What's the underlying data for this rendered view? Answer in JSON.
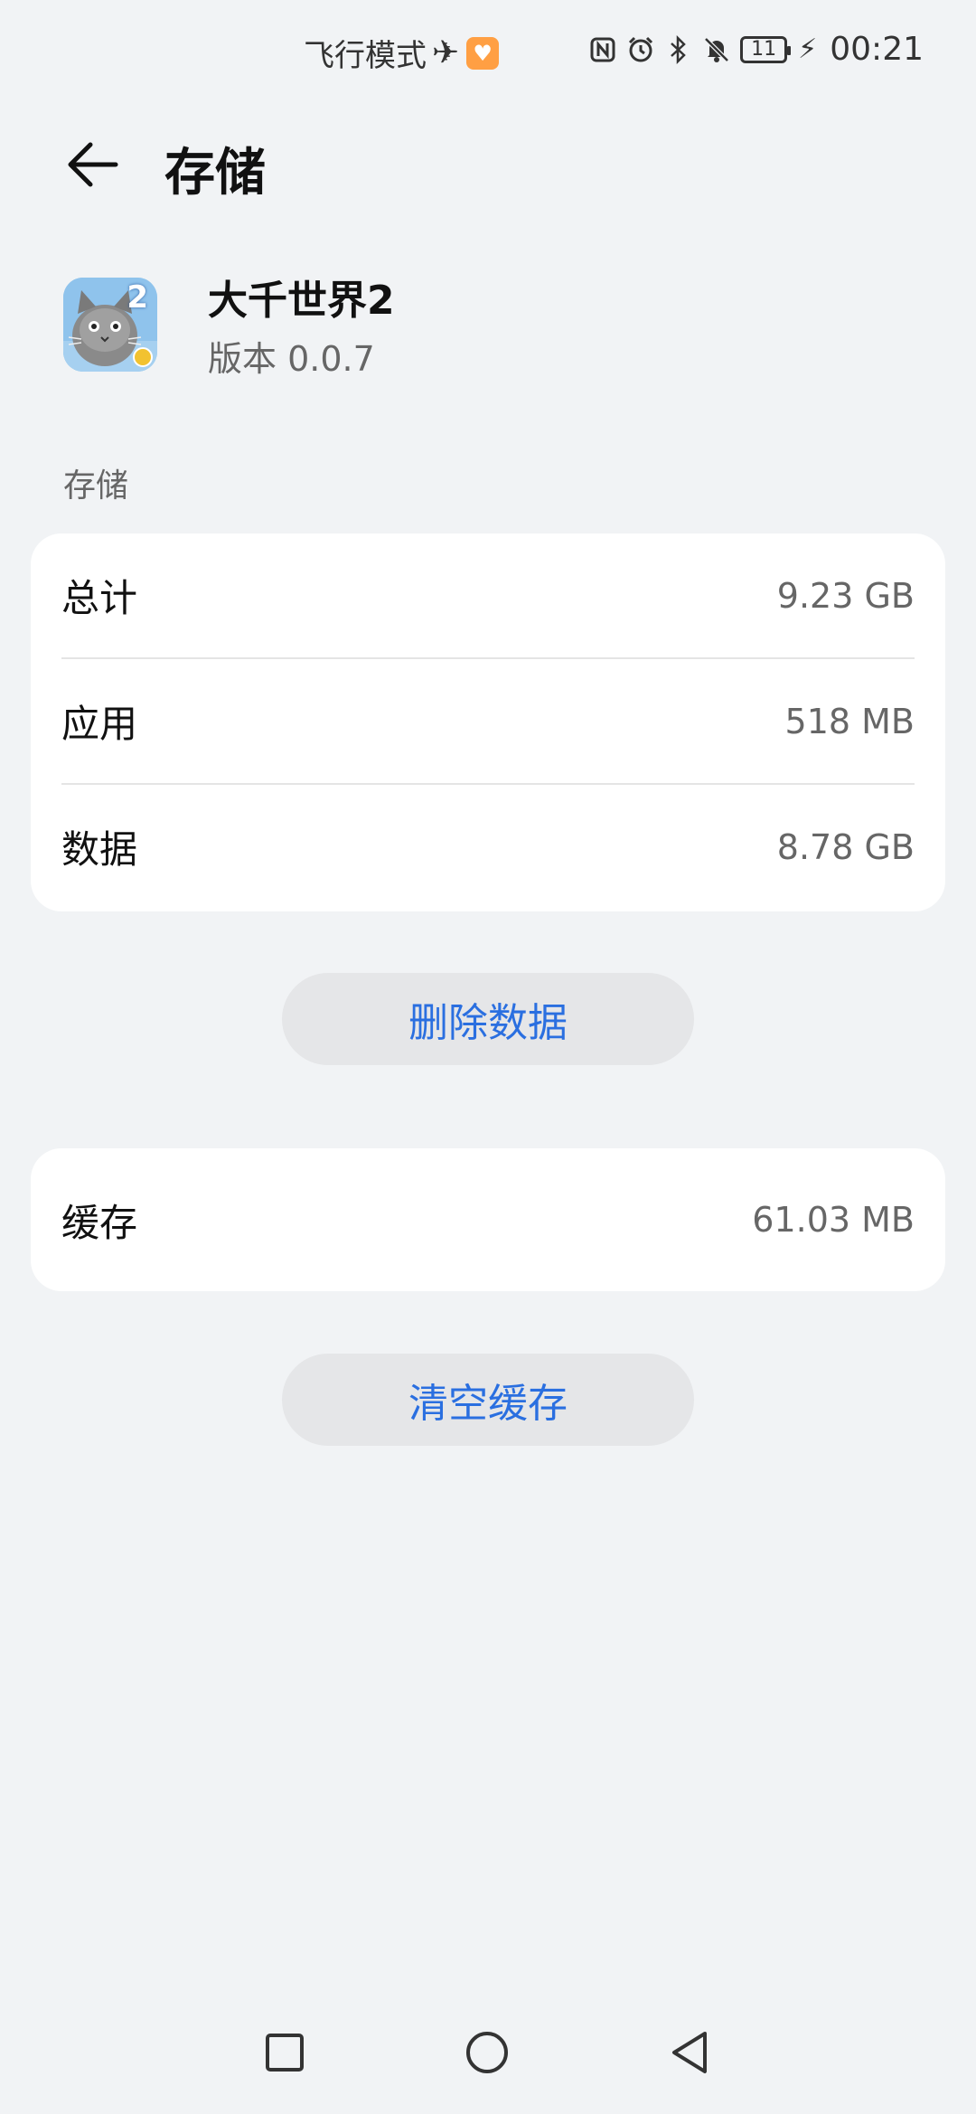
{
  "status_bar": {
    "airplane_mode_label": "飞行模式",
    "battery_level": "11",
    "time": "00:21"
  },
  "header": {
    "title": "存储"
  },
  "app": {
    "name": "大千世界2",
    "version": "版本 0.0.7",
    "icon_badge_number": "2"
  },
  "storage_section": {
    "label": "存储",
    "rows": [
      {
        "label": "总计",
        "value": "9.23 GB"
      },
      {
        "label": "应用",
        "value": "518 MB"
      },
      {
        "label": "数据",
        "value": "8.78 GB"
      }
    ],
    "delete_button": "删除数据"
  },
  "cache_section": {
    "label": "缓存",
    "value": "61.03 MB",
    "clear_button": "清空缓存"
  },
  "icons": {
    "back": "back-arrow-icon",
    "airplane": "airplane-icon",
    "health": "health-app-icon",
    "nfc": "nfc-icon",
    "alarm": "alarm-icon",
    "bluetooth": "bluetooth-icon",
    "mute": "bell-muted-icon",
    "charging": "charging-bolt-icon"
  },
  "colors": {
    "accent": "#2a6fe0",
    "background": "#f1f3f5",
    "card": "#ffffff"
  }
}
